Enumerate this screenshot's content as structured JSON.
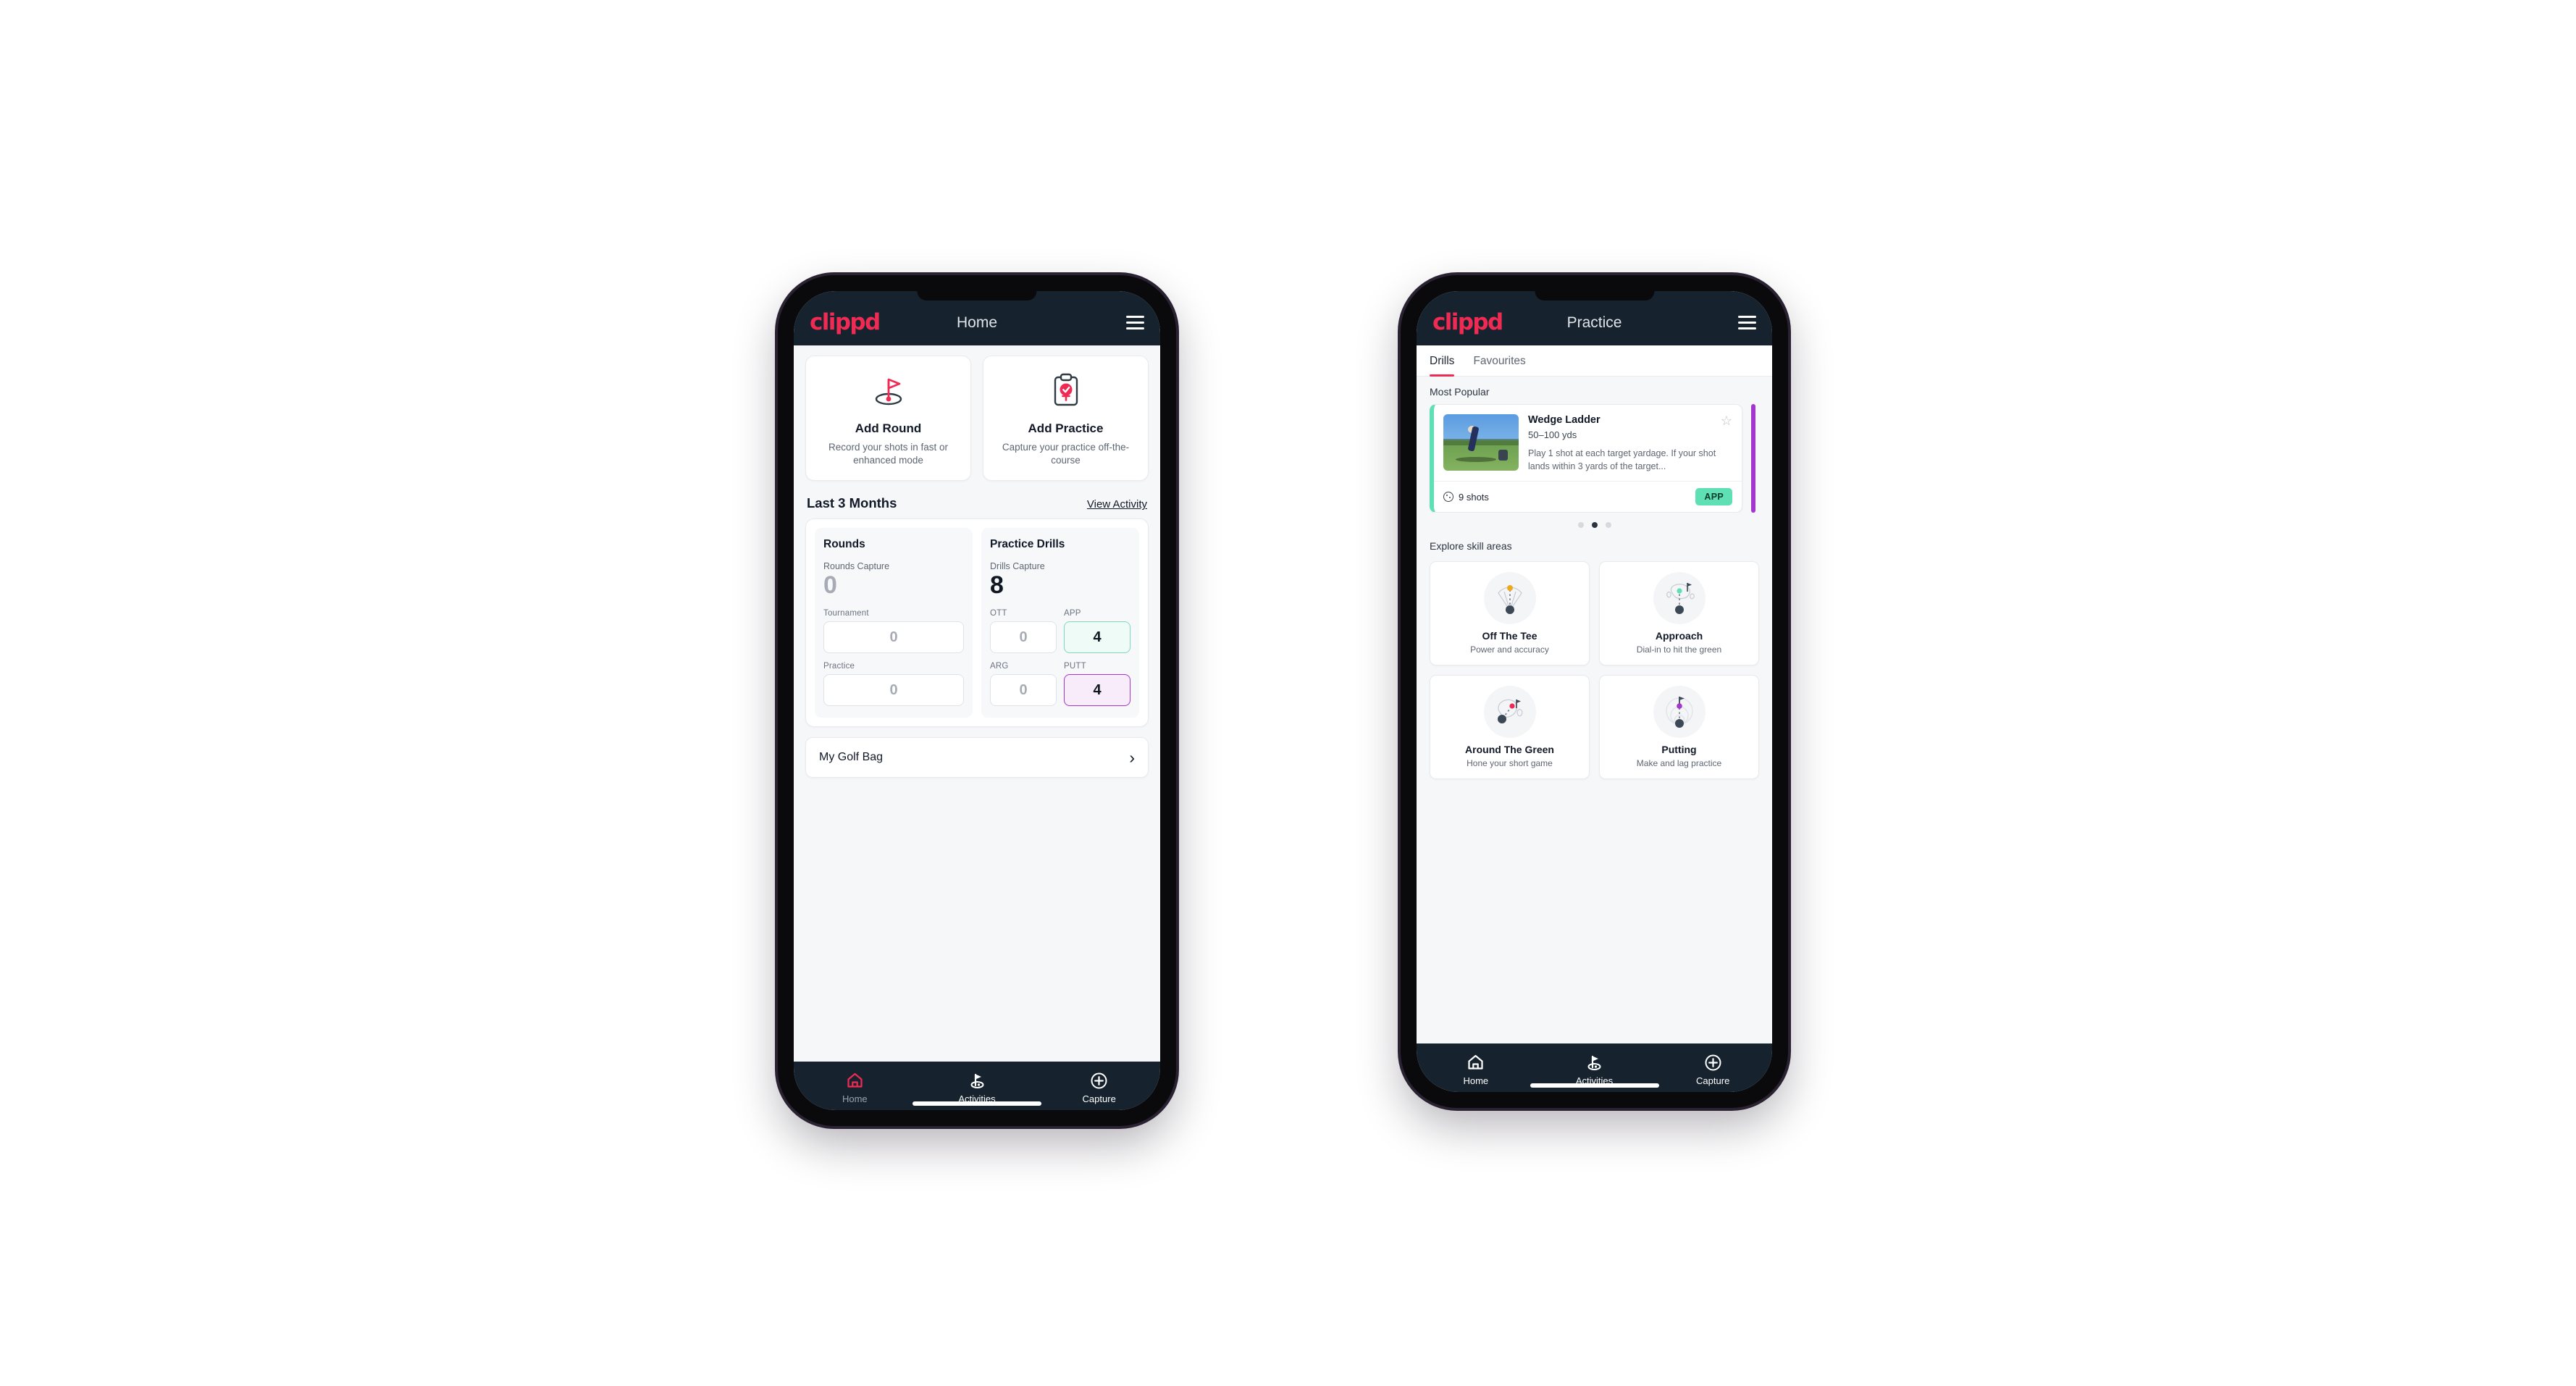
{
  "brand": {
    "logo_text": "clippd",
    "accent": "#ef2a53",
    "dark": "#16232e"
  },
  "phone_home": {
    "appbar": {
      "title": "Home",
      "menu_icon": "hamburger-menu-icon"
    },
    "actions": [
      {
        "icon": "golf-flag-icon",
        "title": "Add Round",
        "desc": "Record your shots in fast or enhanced mode"
      },
      {
        "icon": "clipboard-check-icon",
        "title": "Add Practice",
        "desc": "Capture your practice off-the-course"
      }
    ],
    "section": {
      "title": "Last 3 Months",
      "link": "View Activity"
    },
    "rounds": {
      "heading": "Rounds",
      "capture_label": "Rounds Capture",
      "capture_value": "0",
      "items": [
        {
          "label": "Tournament",
          "value": "0"
        },
        {
          "label": "Practice",
          "value": "0"
        }
      ]
    },
    "drills": {
      "heading": "Practice Drills",
      "capture_label": "Drills Capture",
      "capture_value": "8",
      "items": [
        {
          "label": "OTT",
          "value": "0",
          "state": "empty"
        },
        {
          "label": "APP",
          "value": "4",
          "state": "app"
        },
        {
          "label": "ARG",
          "value": "0",
          "state": "empty"
        },
        {
          "label": "PUTT",
          "value": "4",
          "state": "putt"
        }
      ]
    },
    "bag": {
      "label": "My Golf Bag",
      "chevron": "chevron-right-icon"
    },
    "nav": [
      {
        "icon": "home-icon",
        "label": "Home",
        "active": true
      },
      {
        "icon": "golf-activities-icon",
        "label": "Activities",
        "active": false
      },
      {
        "icon": "plus-circle-icon",
        "label": "Capture",
        "active": false
      }
    ]
  },
  "phone_practice": {
    "appbar": {
      "title": "Practice",
      "menu_icon": "hamburger-menu-icon"
    },
    "tabs": [
      {
        "label": "Drills",
        "active": true
      },
      {
        "label": "Favourites",
        "active": false
      }
    ],
    "most_popular_label": "Most Popular",
    "drill": {
      "title": "Wedge Ladder",
      "subtitle": "50–100 yds",
      "description": "Play 1 shot at each target yardage. If your shot lands within 3 yards of the target...",
      "shots": "9 shots",
      "chip": "APP",
      "chip_color": "#5fe0b4",
      "accent": "#5fe0b4",
      "star": "star-outline-icon"
    },
    "next_accent": "#a435cf",
    "dots": [
      false,
      true,
      false
    ],
    "skill_label": "Explore skill areas",
    "skills": [
      {
        "icon": "off-the-tee-icon",
        "title": "Off The Tee",
        "desc": "Power and accuracy",
        "dot": "#f0a81e"
      },
      {
        "icon": "approach-icon",
        "title": "Approach",
        "desc": "Dial-in to hit the green",
        "dot": "#5fe0b4"
      },
      {
        "icon": "around-the-green-icon",
        "title": "Around The Green",
        "desc": "Hone your short game",
        "dot": "#ef2a53"
      },
      {
        "icon": "putting-icon",
        "title": "Putting",
        "desc": "Make and lag practice",
        "dot": "#a435cf"
      }
    ],
    "nav": [
      {
        "icon": "home-icon",
        "label": "Home",
        "active": false
      },
      {
        "icon": "golf-activities-icon",
        "label": "Activities",
        "active": false
      },
      {
        "icon": "plus-circle-icon",
        "label": "Capture",
        "active": false
      }
    ]
  }
}
